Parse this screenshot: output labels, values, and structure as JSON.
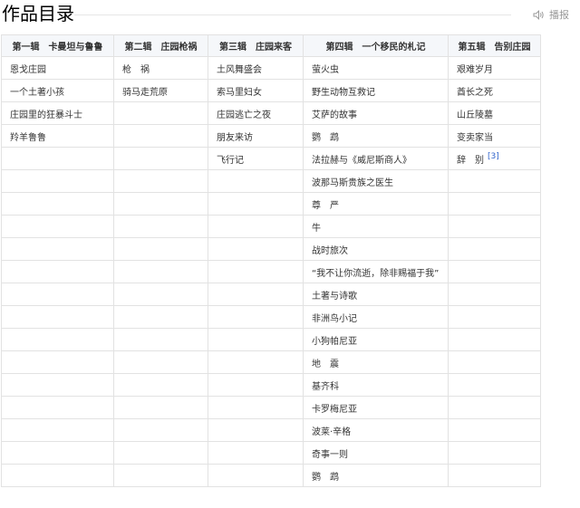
{
  "header": {
    "title": "作品目录",
    "speak_label": "播报",
    "speak_icon": "speaker-icon"
  },
  "table": {
    "columns": [
      "第一辑　卡曼坦与鲁鲁",
      "第二辑　庄园枪祸",
      "第三辑　庄园来客",
      "第四辑　一个移民的札记",
      "第五辑　告别庄园"
    ],
    "rows": [
      [
        "恩戈庄园",
        "枪　祸",
        "土风舞盛会",
        "萤火虫",
        "艰难岁月"
      ],
      [
        "一个土著小孩",
        "骑马走荒原",
        "索马里妇女",
        "野生动物互救记",
        "酋长之死"
      ],
      [
        "庄园里的狂暴斗士",
        "",
        "庄园逃亡之夜",
        "艾萨的故事",
        "山丘陵墓"
      ],
      [
        "羚羊鲁鲁",
        "",
        "朋友来访",
        "鹦　鹉",
        "变卖家当"
      ],
      [
        "",
        "",
        "飞行记",
        "法拉赫与《威尼斯商人》",
        "辞　别"
      ],
      [
        "",
        "",
        "",
        "波那马斯贵族之医生",
        ""
      ],
      [
        "",
        "",
        "",
        "尊　严",
        ""
      ],
      [
        "",
        "",
        "",
        "牛",
        ""
      ],
      [
        "",
        "",
        "",
        "战时旅次",
        ""
      ],
      [
        "",
        "",
        "",
        "“我不让你流逝，除非赐福于我”",
        ""
      ],
      [
        "",
        "",
        "",
        "土著与诗歌",
        ""
      ],
      [
        "",
        "",
        "",
        "非洲鸟小记",
        ""
      ],
      [
        "",
        "",
        "",
        "小狗帕尼亚",
        ""
      ],
      [
        "",
        "",
        "",
        "地　震",
        ""
      ],
      [
        "",
        "",
        "",
        "基齐科",
        ""
      ],
      [
        "",
        "",
        "",
        "卡罗梅尼亚",
        ""
      ],
      [
        "",
        "",
        "",
        "波莱·辛格",
        ""
      ],
      [
        "",
        "",
        "",
        "奇事一则",
        ""
      ],
      [
        "",
        "",
        "",
        "鹦　鹉",
        ""
      ]
    ],
    "references": [
      {
        "row": 4,
        "col": 4,
        "label": "[3]"
      }
    ]
  },
  "colors": {
    "header_bg": "#f5f7fa",
    "border": "#e2e2e2",
    "link": "#3366cc",
    "muted": "#999999"
  }
}
